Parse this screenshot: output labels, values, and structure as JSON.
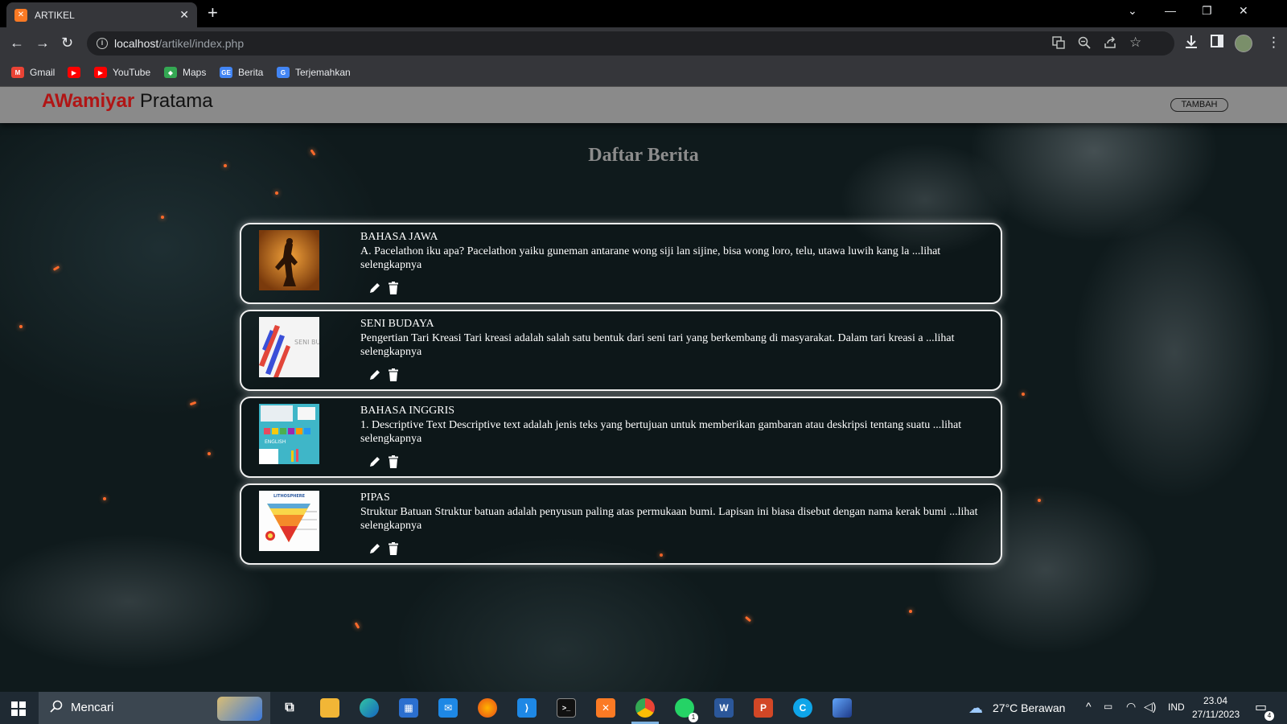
{
  "browser": {
    "tab_title": "ARTIKEL",
    "tab_favicon": "xampp-icon",
    "new_tab": "+",
    "url_host": "localhost",
    "url_path": "/artikel/index.php",
    "bookmarks": [
      {
        "label": "Gmail",
        "icon": "gmail-icon",
        "color": "#ea4335"
      },
      {
        "label": "",
        "icon": "youtube-icon",
        "color": "#ff0000"
      },
      {
        "label": "YouTube",
        "icon": "youtube-icon",
        "color": "#ff0000"
      },
      {
        "label": "Maps",
        "icon": "maps-icon",
        "color": "#34a853"
      },
      {
        "label": "Berita",
        "icon": "google-news-icon",
        "color": "#4285f4"
      },
      {
        "label": "Terjemahkan",
        "icon": "google-translate-icon",
        "color": "#4285f4"
      }
    ]
  },
  "header": {
    "brand_accent": "AWamiyar",
    "brand_rest": " Pratama",
    "brand_accent_color": "#b01515",
    "add_button": "TAMBAH"
  },
  "main": {
    "title": "Daftar Berita",
    "articles": [
      {
        "title": "BAHASA JAWA",
        "excerpt": "A. Pacelathon iku apa? Pacelathon yaiku guneman antarane wong siji lan sijine, bisa wong loro, telu, utawa luwih kang la ...lihat selengkapnya",
        "thumb": "wayang-image"
      },
      {
        "title": "SENI BUDAYA",
        "excerpt": "Pengertian Tari Kreasi Tari kreasi adalah salah satu bentuk dari seni tari yang berkembang di masyarakat. Dalam tari kreasi a ...lihat selengkapnya",
        "thumb": "seni-budaya-image",
        "thumb_text": "SENI BUDAYA"
      },
      {
        "title": "BAHASA INGGRIS",
        "excerpt": "1. Descriptive Text Descriptive text adalah jenis teks yang bertujuan untuk memberikan gambaran atau deskripsi tentang suatu ...lihat selengkapnya",
        "thumb": "english-image",
        "thumb_text": "ENGLISH"
      },
      {
        "title": "PIPAS",
        "excerpt": "Struktur Batuan Struktur batuan adalah penyusun paling atas permukaan bumi. Lapisan ini biasa disebut dengan nama kerak bumi ...lihat selengkapnya",
        "thumb": "lithosphere-image",
        "thumb_text": "LITHOSPHERE"
      }
    ],
    "edit_icon": "pencil-icon",
    "delete_icon": "trash-icon"
  },
  "taskbar": {
    "search_placeholder": "Mencari",
    "weather": "27°C  Berawan",
    "language": "IND",
    "time": "23.04",
    "date": "27/11/2023",
    "whatsapp_badge": "1",
    "notification_badge": "4"
  }
}
